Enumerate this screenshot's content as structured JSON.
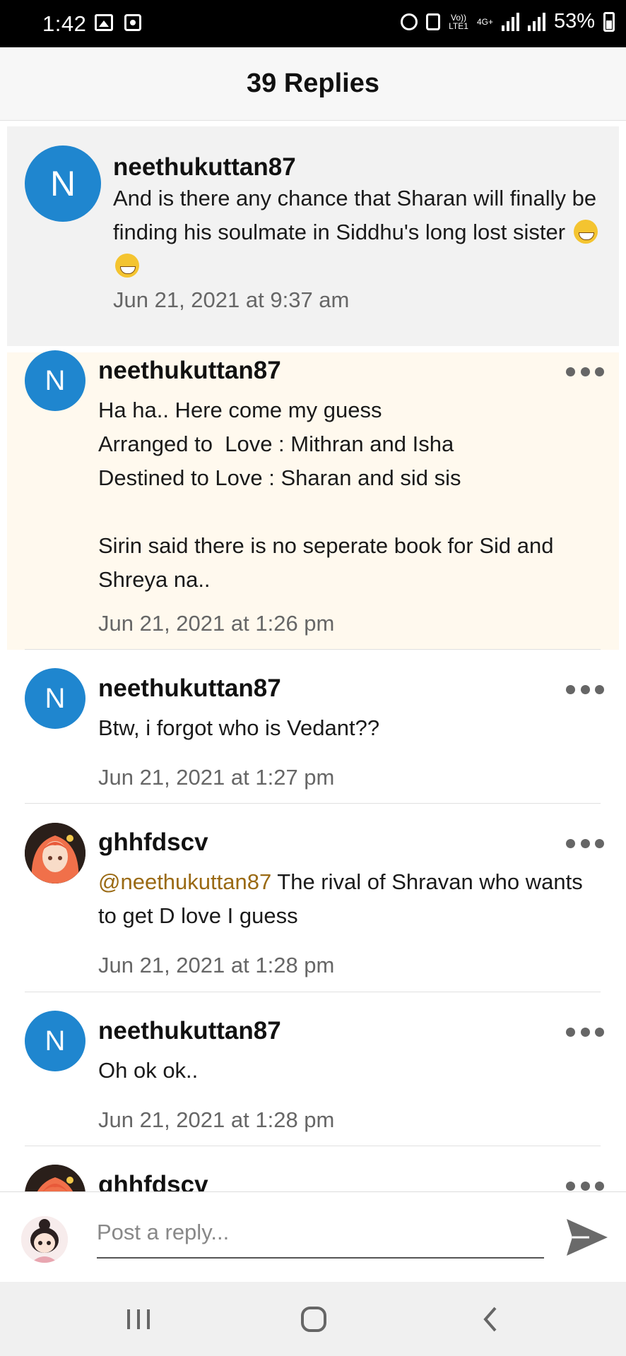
{
  "status_bar": {
    "time": "1:42",
    "volte": "Vo))",
    "lte": "LTE1",
    "network": "4G+",
    "battery": "53%"
  },
  "header": {
    "title": "39 Replies"
  },
  "parent": {
    "avatar_letter": "N",
    "username": "neethukuttan87",
    "text": "And is there any chance that Sharan will finally be finding his soulmate in Siddhu's long lost sister",
    "emoji": "grinning-face-emoji",
    "timestamp": "Jun 21, 2021 at 9:37 am"
  },
  "replies": [
    {
      "avatar_letter": "N",
      "username": "neethukuttan87",
      "text": "Ha ha.. Here come my guess\nArranged to  Love : Mithran and Isha\nDestined to Love : Sharan and sid sis\n\nSirin said there is no seperate book for Sid and Shreya na..",
      "timestamp": "Jun 21, 2021 at 1:26 pm"
    },
    {
      "avatar_letter": "N",
      "username": "neethukuttan87",
      "text": "Btw, i forgot who is Vedant??",
      "timestamp": "Jun 21, 2021 at 1:27 pm"
    },
    {
      "username": "ghhfdscv",
      "mention": "@neethukuttan87",
      "text": " The rival of Shravan who wants to get D love I guess",
      "timestamp": "Jun 21, 2021 at 1:28 pm"
    },
    {
      "avatar_letter": "N",
      "username": "neethukuttan87",
      "text": "Oh ok ok..",
      "timestamp": "Jun 21, 2021 at 1:28 pm"
    },
    {
      "username": "ghhfdscv"
    }
  ],
  "reply_bar": {
    "placeholder": "Post a reply..."
  },
  "colors": {
    "avatar_blue": "#1f86cf",
    "mention": "#9a6a14",
    "highlight_bg": "#fff9ee"
  },
  "icons": {
    "more": "more-dots-icon",
    "send": "send-icon",
    "nav_recent": "recent-apps-icon",
    "nav_home": "home-icon",
    "nav_back": "back-icon"
  }
}
